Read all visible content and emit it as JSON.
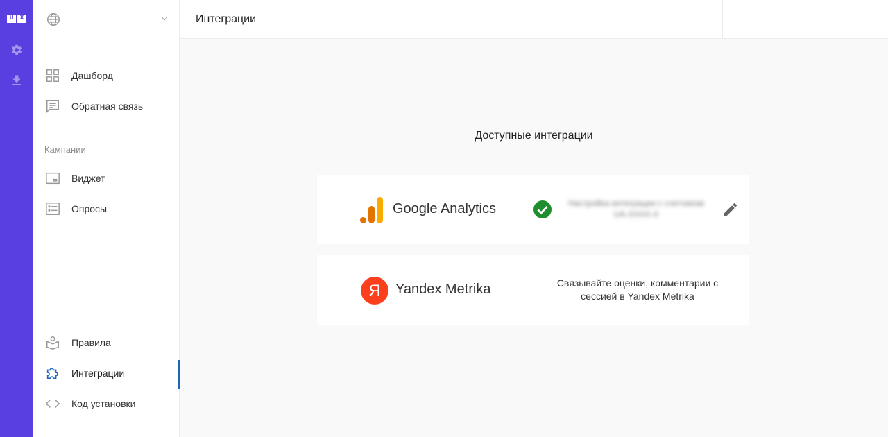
{
  "rail": {
    "logo": [
      "U",
      "X"
    ],
    "icons": [
      "settings-icon",
      "download-icon"
    ]
  },
  "sidebar": {
    "workspace_icon": "globe-icon",
    "items": [
      {
        "label": "Дашборд",
        "icon": "grid-icon"
      },
      {
        "label": "Обратная связь",
        "icon": "message-icon"
      },
      {
        "label": "Виджет",
        "icon": "widget-icon"
      },
      {
        "label": "Опросы",
        "icon": "survey-icon"
      },
      {
        "label": "Правила",
        "icon": "rules-icon"
      },
      {
        "label": "Интеграции",
        "icon": "puzzle-icon",
        "active": true
      },
      {
        "label": "Код установки",
        "icon": "code-icon"
      }
    ],
    "section_campaigns": "Кампании"
  },
  "header": {
    "title": "Интеграции"
  },
  "main": {
    "heading": "Доступные интеграции",
    "integrations": [
      {
        "name": "Google Analytics",
        "status": "connected",
        "description": "Настройка интеграции с счетчиком UA-XXXX-X"
      },
      {
        "name": "Yandex Metrika",
        "description": "Связывайте оценки, комментарии с сессией в Yandex Metrika"
      }
    ]
  },
  "colors": {
    "rail": "#5a3fe0",
    "active_indicator": "#1f66b8",
    "check": "#1e8e2e",
    "yandex_red": "#fc3f1d",
    "ga_orange": "#f9ab00",
    "ga_dark_orange": "#e37400"
  }
}
